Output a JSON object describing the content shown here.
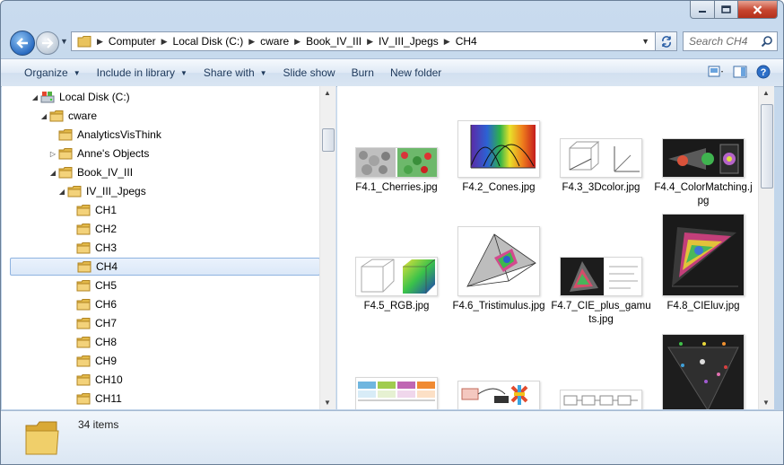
{
  "window": {
    "caption": {
      "minimize": "minimize-icon",
      "maximize": "maximize-icon",
      "close": "close-icon"
    }
  },
  "address": {
    "crumbs": [
      "Computer",
      "Local Disk (C:)",
      "cware",
      "Book_IV_III",
      "IV_III_Jpegs",
      "CH4"
    ],
    "search_placeholder": "Search CH4"
  },
  "toolbar": {
    "organize": "Organize",
    "include": "Include in library",
    "share": "Share with",
    "slideshow": "Slide show",
    "burn": "Burn",
    "new_folder": "New folder"
  },
  "tree": {
    "items": [
      {
        "label": "Local Disk (C:)",
        "level": 0,
        "arrow": "expanded",
        "icon": "drive-icon"
      },
      {
        "label": "cware",
        "level": 1,
        "arrow": "expanded",
        "icon": "folder-icon"
      },
      {
        "label": "AnalyticsVisThink",
        "level": 2,
        "arrow": "none",
        "icon": "folder-icon"
      },
      {
        "label": "Anne's Objects",
        "level": 2,
        "arrow": "collapsed",
        "icon": "folder-icon"
      },
      {
        "label": "Book_IV_III",
        "level": 2,
        "arrow": "expanded",
        "icon": "folder-icon"
      },
      {
        "label": "IV_III_Jpegs",
        "level": 3,
        "arrow": "expanded",
        "icon": "folder-icon"
      },
      {
        "label": "CH1",
        "level": 4,
        "arrow": "none",
        "icon": "folder-icon"
      },
      {
        "label": "CH2",
        "level": 4,
        "arrow": "none",
        "icon": "folder-icon"
      },
      {
        "label": "CH3",
        "level": 4,
        "arrow": "none",
        "icon": "folder-icon"
      },
      {
        "label": "CH4",
        "level": 4,
        "arrow": "none",
        "icon": "folder-icon",
        "selected": true
      },
      {
        "label": "CH5",
        "level": 4,
        "arrow": "none",
        "icon": "folder-icon"
      },
      {
        "label": "CH6",
        "level": 4,
        "arrow": "none",
        "icon": "folder-icon"
      },
      {
        "label": "CH7",
        "level": 4,
        "arrow": "none",
        "icon": "folder-icon"
      },
      {
        "label": "CH8",
        "level": 4,
        "arrow": "none",
        "icon": "folder-icon"
      },
      {
        "label": "CH9",
        "level": 4,
        "arrow": "none",
        "icon": "folder-icon"
      },
      {
        "label": "CH10",
        "level": 4,
        "arrow": "none",
        "icon": "folder-icon"
      },
      {
        "label": "CH11",
        "level": 4,
        "arrow": "none",
        "icon": "folder-icon"
      }
    ]
  },
  "files": [
    {
      "name": "F4.1_Cherries.jpg"
    },
    {
      "name": "F4.2_Cones.jpg"
    },
    {
      "name": "F4.3_3Dcolor.jpg"
    },
    {
      "name": "F4.4_ColorMatching.jpg"
    },
    {
      "name": "F4.5_RGB.jpg"
    },
    {
      "name": "F4.6_Tristimulus.jpg"
    },
    {
      "name": "F4.7_CIE_plus_gamuts.jpg"
    },
    {
      "name": "F4.8_CIEluv.jpg"
    },
    {
      "name": ""
    },
    {
      "name": ""
    },
    {
      "name": ""
    },
    {
      "name": ""
    }
  ],
  "details": {
    "count": "34 items"
  }
}
